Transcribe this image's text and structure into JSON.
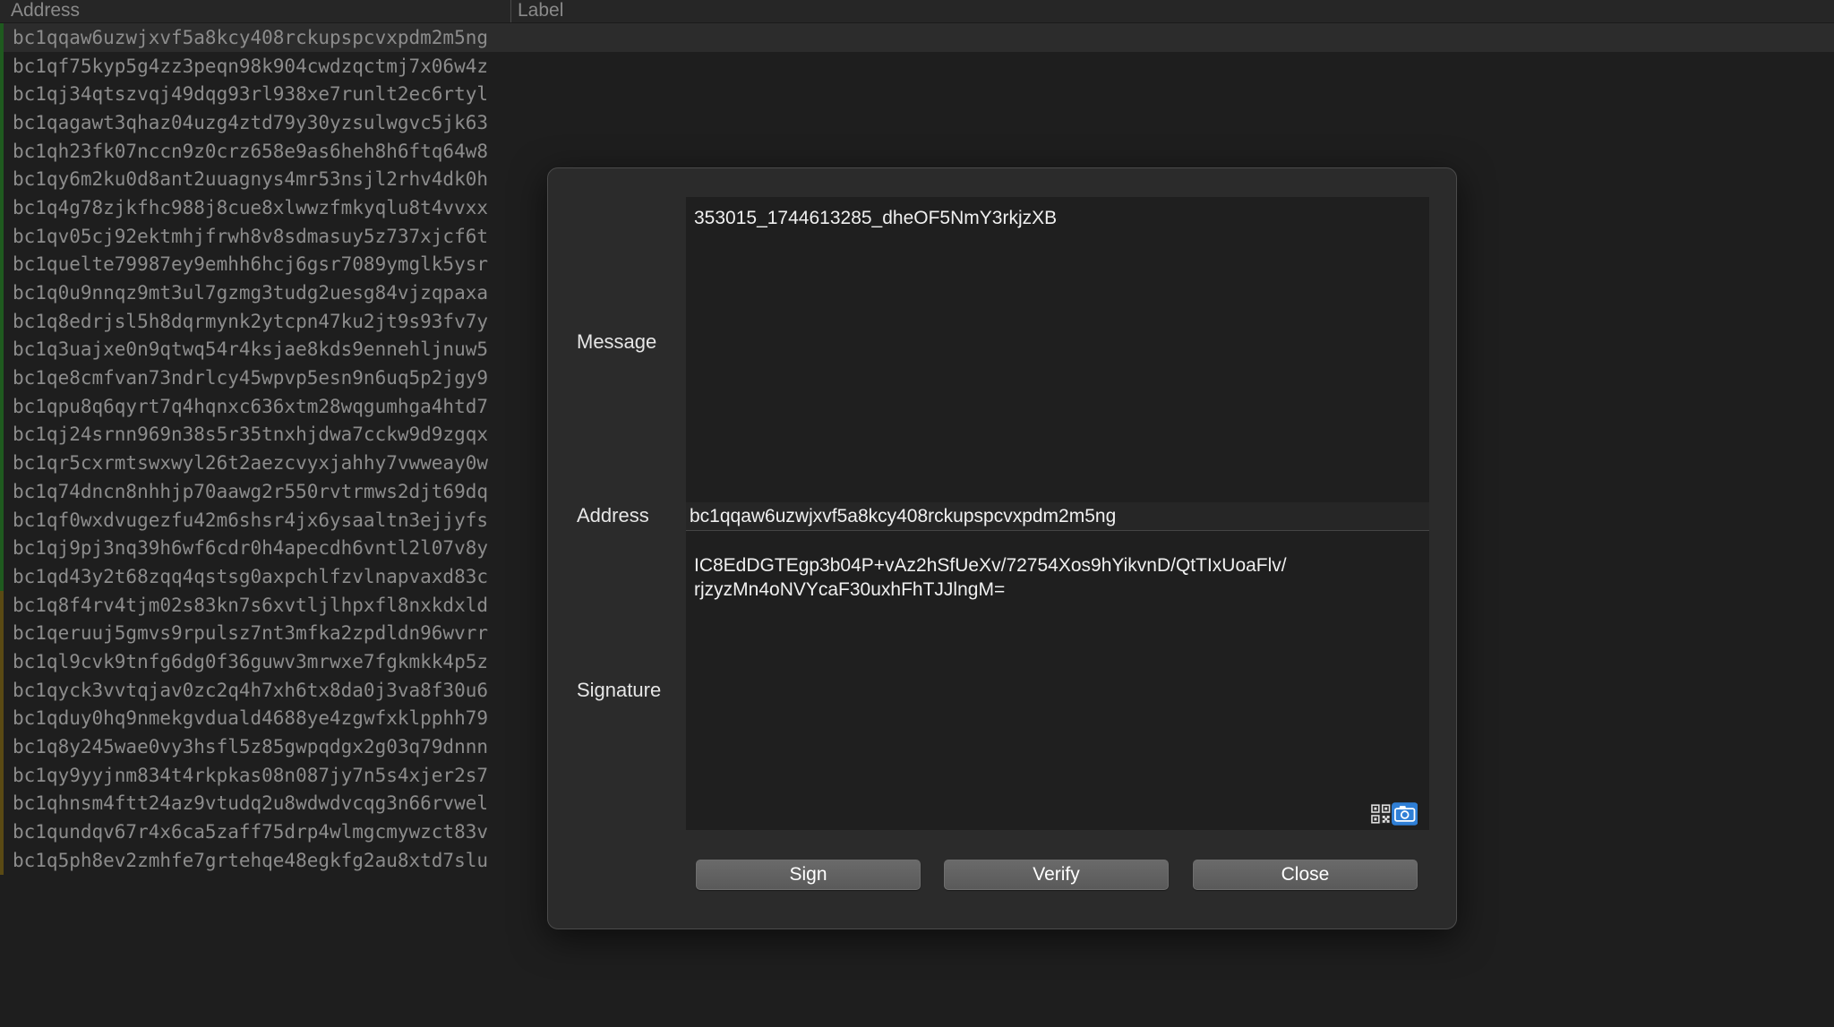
{
  "table": {
    "columns": {
      "address": "Address",
      "label": "Label"
    },
    "marker_colors": {
      "green": "#1f5a1f",
      "olive": "#5a4a14"
    },
    "rows": [
      {
        "address": "bc1qqaw6uzwjxvf5a8kcy408rckupspcvxpdm2m5ng",
        "marker": "green",
        "selected": true
      },
      {
        "address": "bc1qf75kyp5g4zz3peqn98k904cwdzqctmj7x06w4z",
        "marker": "green"
      },
      {
        "address": "bc1qj34qtszvqj49dqg93rl938xe7runlt2ec6rtyl",
        "marker": "green"
      },
      {
        "address": "bc1qagawt3qhaz04uzg4ztd79y30yzsulwgvc5jk63",
        "marker": "green"
      },
      {
        "address": "bc1qh23fk07nccn9z0crz658e9as6heh8h6ftq64w8",
        "marker": "green"
      },
      {
        "address": "bc1qy6m2ku0d8ant2uuagnys4mr53nsjl2rhv4dk0h",
        "marker": "green"
      },
      {
        "address": "bc1q4g78zjkfhc988j8cue8xlwwzfmkyqlu8t4vvxx",
        "marker": "green"
      },
      {
        "address": "bc1qv05cj92ektmhjfrwh8v8sdmasuy5z737xjcf6t",
        "marker": "green"
      },
      {
        "address": "bc1quelte79987ey9emhh6hcj6gsr7089ymglk5ysr",
        "marker": "green"
      },
      {
        "address": "bc1q0u9nnqz9mt3ul7gzmg3tudg2uesg84vjzqpaxa",
        "marker": "green"
      },
      {
        "address": "bc1q8edrjsl5h8dqrmynk2ytcpn47ku2jt9s93fv7y",
        "marker": "green"
      },
      {
        "address": "bc1q3uajxe0n9qtwq54r4ksjae8kds9ennehljnuw5",
        "marker": "green"
      },
      {
        "address": "bc1qe8cmfvan73ndrlcy45wpvp5esn9n6uq5p2jgy9",
        "marker": "green"
      },
      {
        "address": "bc1qpu8q6qyrt7q4hqnxc636xtm28wqgumhga4htd7",
        "marker": "green"
      },
      {
        "address": "bc1qj24srnn969n38s5r35tnxhjdwa7cckw9d9zgqx",
        "marker": "green"
      },
      {
        "address": "bc1qr5cxrmtswxwyl26t2aezcvyxjahhy7vwweay0w",
        "marker": "green"
      },
      {
        "address": "bc1q74dncn8nhhjp70aawg2r550rvtrmws2djt69dq",
        "marker": "green"
      },
      {
        "address": "bc1qf0wxdvugezfu42m6shsr4jx6ysaaltn3ejjyfs",
        "marker": "green"
      },
      {
        "address": "bc1qj9pj3nq39h6wf6cdr0h4apecdh6vntl2l07v8y",
        "marker": "green"
      },
      {
        "address": "bc1qd43y2t68zqq4qstsg0axpchlfzvlnapvaxd83c",
        "marker": "green"
      },
      {
        "address": "bc1q8f4rv4tjm02s83kn7s6xvtljlhpxfl8nxkdxld",
        "marker": "olive"
      },
      {
        "address": "bc1qeruuj5gmvs9rpulsz7nt3mfka2zpdldn96wvrr",
        "marker": "olive"
      },
      {
        "address": "bc1ql9cvk9tnfg6dg0f36guwv3mrwxe7fgkmkk4p5z",
        "marker": "olive"
      },
      {
        "address": "bc1qyck3vvtqjav0zc2q4h7xh6tx8da0j3va8f30u6",
        "marker": "olive"
      },
      {
        "address": "bc1qduy0hq9nmekgvduald4688ye4zgwfxklpphh79",
        "marker": "olive"
      },
      {
        "address": "bc1q8y245wae0vy3hsfl5z85gwpqdgx2g03q79dnnn",
        "marker": "olive"
      },
      {
        "address": "bc1qy9yyjnm834t4rkpkas08n087jy7n5s4xjer2s7",
        "marker": "olive"
      },
      {
        "address": "bc1qhnsm4ftt24az9vtudq2u8wdwdvcqg3n66rvwel",
        "marker": "olive"
      },
      {
        "address": "bc1qundqv67r4x6ca5zaff75drp4wlmgcmywzct83v",
        "marker": "olive"
      },
      {
        "address": "bc1q5ph8ev2zmhfe7grtehqe48egkfg2au8xtd7slu",
        "marker": "olive"
      }
    ]
  },
  "dialog": {
    "message_label": "Message",
    "message_value": "353015_1744613285_dheOF5NmY3rkjzXB",
    "address_label": "Address",
    "address_value": "bc1qqaw6uzwjxvf5a8kcy408rckupspcvxpdm2m5ng",
    "signature_label": "Signature",
    "signature_value": "IC8EdDGTEgp3b04P+vAz2hSfUeXv/72754Xos9hYikvnD/QtTIxUoaFlv/\nrjzyzMn4oNVYcaF30uxhFhTJJlngM=",
    "qr_icon": "qr-code-icon",
    "camera_icon": "camera-icon",
    "sign_label": "Sign",
    "verify_label": "Verify",
    "close_label": "Close"
  }
}
